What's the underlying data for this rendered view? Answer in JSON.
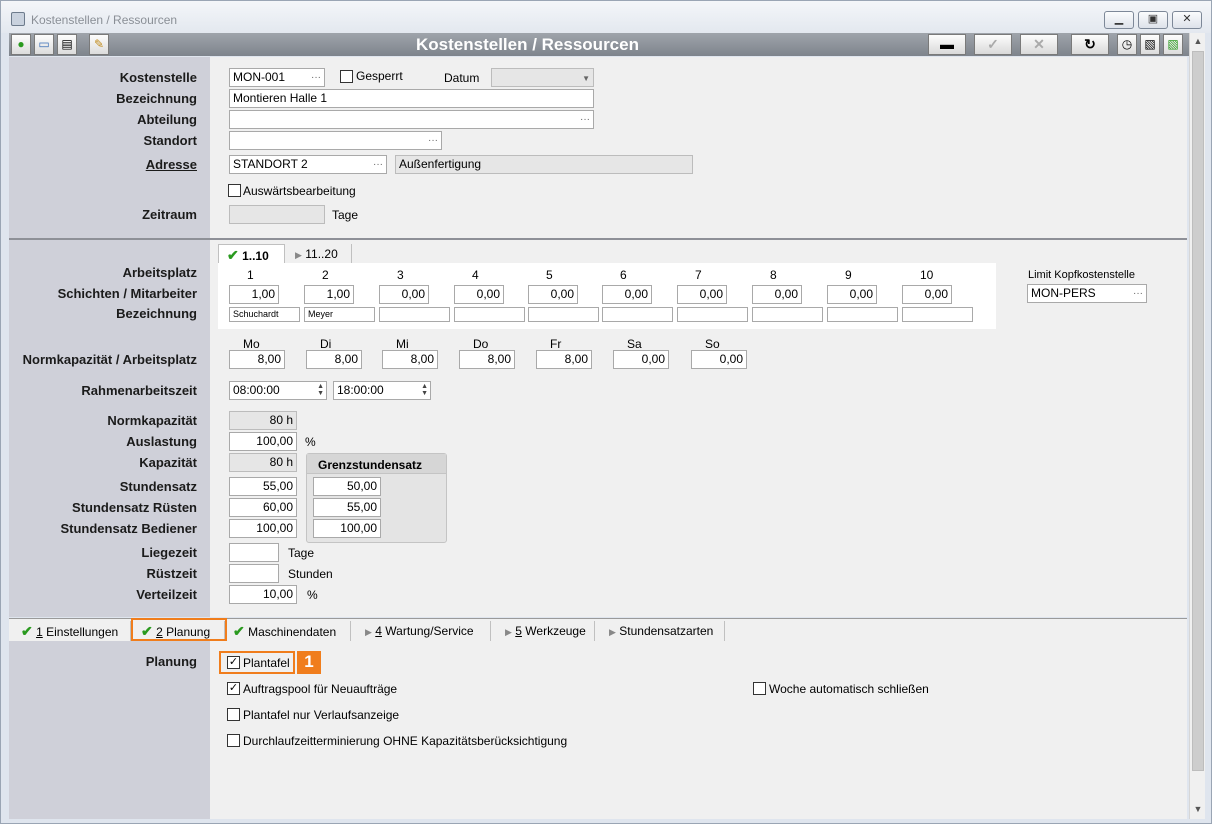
{
  "window": {
    "title": "Kostenstellen / Ressourcen",
    "toolbar_title": "Kostenstellen / Ressourcen"
  },
  "header": {
    "kostenstelle_label": "Kostenstelle",
    "kostenstelle_value": "MON-001",
    "gesperrt_label": "Gesperrt",
    "datum_label": "Datum",
    "bezeichnung_label": "Bezeichnung",
    "bezeichnung_value": "Montieren Halle 1",
    "abteilung_label": "Abteilung",
    "standort_label": "Standort",
    "adresse_label": "Adresse",
    "adresse_value": "STANDORT 2",
    "adresse_desc": "Außenfertigung",
    "auswaerts_label": "Auswärtsbearbeitung",
    "zeitraum_label": "Zeitraum",
    "zeitraum_unit": "Tage"
  },
  "workplaces": {
    "tabs": [
      {
        "label": "1..10",
        "active": true
      },
      {
        "label": "11..20",
        "active": false
      }
    ],
    "arbeitsplatz_label": "Arbeitsplatz",
    "schichten_label": "Schichten / Mitarbeiter",
    "bezeichnung_label": "Bezeichnung",
    "numbers": [
      "1",
      "2",
      "3",
      "4",
      "5",
      "6",
      "7",
      "8",
      "9",
      "10"
    ],
    "schichten": [
      "1,00",
      "1,00",
      "0,00",
      "0,00",
      "0,00",
      "0,00",
      "0,00",
      "0,00",
      "0,00",
      "0,00"
    ],
    "names": [
      "Schuchardt",
      "Meyer",
      "",
      "",
      "",
      "",
      "",
      "",
      "",
      ""
    ],
    "limit_label": "Limit Kopfkostenstelle",
    "limit_value": "MON-PERS"
  },
  "capacity": {
    "norm_ap_label": "Normkapazität / Arbeitsplatz",
    "days": [
      "Mo",
      "Di",
      "Mi",
      "Do",
      "Fr",
      "Sa",
      "So"
    ],
    "values": [
      "8,00",
      "8,00",
      "8,00",
      "8,00",
      "8,00",
      "0,00",
      "0,00"
    ],
    "rahmen_label": "Rahmenarbeitszeit",
    "rahmen_from": "08:00:00",
    "rahmen_to": "18:00:00",
    "normkap_label": "Normkapazität",
    "normkap_value": "80 h",
    "auslastung_label": "Auslastung",
    "auslastung_value": "100,00",
    "auslastung_unit": "%",
    "kapazitaet_label": "Kapazität",
    "kapazitaet_value": "80 h",
    "grenz_title": "Grenzstundensatz",
    "stundensatz_label": "Stundensatz",
    "stundensatz_value": "55,00",
    "stundensatz_grenz": "50,00",
    "ruesten_label": "Stundensatz Rüsten",
    "ruesten_value": "60,00",
    "ruesten_grenz": "55,00",
    "bediener_label": "Stundensatz Bediener",
    "bediener_value": "100,00",
    "bediener_grenz": "100,00",
    "liegezeit_label": "Liegezeit",
    "liegezeit_unit": "Tage",
    "ruestzeit_label": "Rüstzeit",
    "ruestzeit_unit": "Stunden",
    "verteilzeit_label": "Verteilzeit",
    "verteilzeit_value": "10,00",
    "verteilzeit_unit": "%"
  },
  "bottom_tabs": [
    {
      "num": "1",
      "label": "Einstellungen"
    },
    {
      "num": "2",
      "label": "Planung"
    },
    {
      "num": "",
      "label": "Maschinendaten"
    },
    {
      "num": "4",
      "label": "Wartung/Service"
    },
    {
      "num": "5",
      "label": "Werkzeuge"
    },
    {
      "num": "",
      "label": "Stundensatzarten"
    }
  ],
  "planung": {
    "label": "Planung",
    "plantafel": "Plantafel",
    "auftragspool": "Auftragspool für Neuaufträge",
    "woche": "Woche automatisch schließen",
    "verlauf": "Plantafel nur Verlaufsanzeige",
    "durchlauf": "Durchlaufzeitterminierung OHNE Kapazitätsberücksichtigung"
  },
  "annotation": {
    "badge": "1"
  },
  "colors": {
    "accent": "#f07d1c",
    "check": "#2a9a1f",
    "panel": "#cfd0d9"
  }
}
